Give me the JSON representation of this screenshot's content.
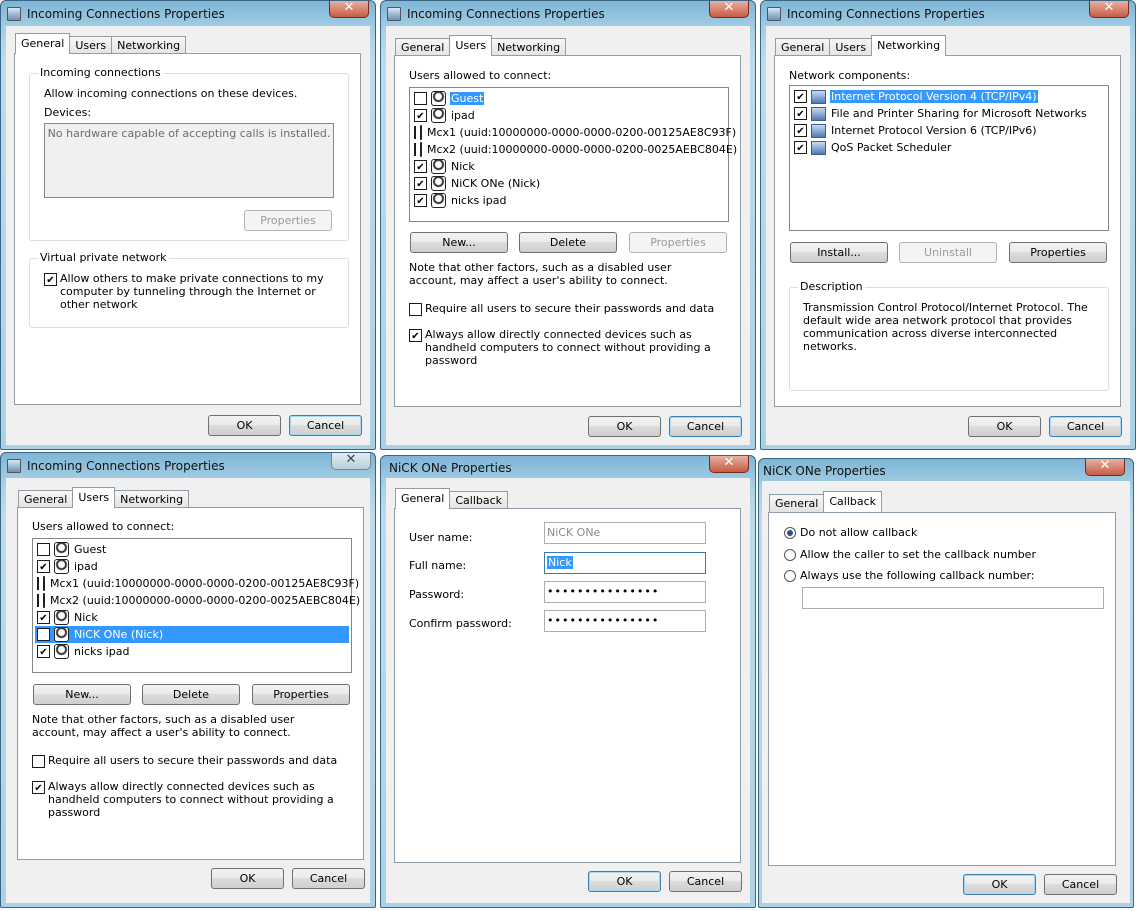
{
  "w1": {
    "title": "Incoming Connections Properties",
    "tabs": [
      "General",
      "Users",
      "Networking"
    ],
    "group_incoming": "Incoming connections",
    "allow_text": "Allow incoming connections on these devices.",
    "devices_label": "Devices:",
    "devices_empty": "No hardware capable of accepting calls is installed.",
    "properties_btn": "Properties",
    "group_vpn": "Virtual private network",
    "vpn_checkbox": "Allow others to make private connections to my computer by tunneling through the Internet or other network",
    "ok": "OK",
    "cancel": "Cancel"
  },
  "w2": {
    "title": "Incoming Connections Properties",
    "tabs": [
      "General",
      "Users",
      "Networking"
    ],
    "users_label": "Users allowed to connect:",
    "users": [
      {
        "name": "Guest",
        "checked": false
      },
      {
        "name": "ipad",
        "checked": true
      },
      {
        "name": "Mcx1 (uuid:10000000-0000-0000-0200-00125AE8C93F)",
        "checked": false
      },
      {
        "name": "Mcx2 (uuid:10000000-0000-0000-0200-0025AEBC804E)",
        "checked": false
      },
      {
        "name": "Nick",
        "checked": true
      },
      {
        "name": "NiCK ONe (Nick)",
        "checked": true
      },
      {
        "name": "nicks ipad",
        "checked": true
      }
    ],
    "new_btn": "New...",
    "delete_btn": "Delete",
    "properties_btn": "Properties",
    "note": "Note that other factors, such as a disabled user account, may affect a user's ability to connect.",
    "require_cb": "Require all users to secure their passwords and data",
    "always_cb": "Always allow directly connected devices such as handheld computers to connect without providing a password",
    "ok": "OK",
    "cancel": "Cancel"
  },
  "w3": {
    "title": "Incoming Connections Properties",
    "tabs": [
      "General",
      "Users",
      "Networking"
    ],
    "components_label": "Network components:",
    "components": [
      {
        "name": "Internet Protocol Version 4 (TCP/IPv4)",
        "checked": true
      },
      {
        "name": "File and Printer Sharing for Microsoft Networks",
        "checked": true
      },
      {
        "name": "Internet Protocol Version 6 (TCP/IPv6)",
        "checked": true
      },
      {
        "name": "QoS Packet Scheduler",
        "checked": true
      }
    ],
    "install_btn": "Install...",
    "uninstall_btn": "Uninstall",
    "properties_btn": "Properties",
    "desc_title": "Description",
    "desc_text": "Transmission Control Protocol/Internet Protocol. The default wide area network protocol that provides communication across diverse interconnected networks.",
    "ok": "OK",
    "cancel": "Cancel"
  },
  "w4": {
    "title": "Incoming Connections Properties",
    "tabs": [
      "General",
      "Users",
      "Networking"
    ],
    "users_label": "Users allowed to connect:",
    "new_btn": "New...",
    "delete_btn": "Delete",
    "properties_btn": "Properties",
    "note": "Note that other factors, such as a disabled user account, may affect a user's ability to connect.",
    "require_cb": "Require all users to secure their passwords and data",
    "always_cb": "Always allow directly connected devices such as handheld computers to connect without providing a password",
    "ok": "OK",
    "cancel": "Cancel"
  },
  "w5": {
    "title": "NiCK ONe Properties",
    "tabs": [
      "General",
      "Callback"
    ],
    "username_label": "User name:",
    "username_value": "NiCK ONe",
    "fullname_label": "Full name:",
    "fullname_value": "Nick",
    "password_label": "Password:",
    "password_value": "•••••••••••••••",
    "confirm_label": "Confirm password:",
    "confirm_value": "•••••••••••••••",
    "ok": "OK",
    "cancel": "Cancel"
  },
  "w6": {
    "title": "NiCK ONe Properties",
    "tabs": [
      "General",
      "Callback"
    ],
    "opt_no": "Do not allow callback",
    "opt_caller": "Allow the caller to set the callback number",
    "opt_always": "Always use the following callback number:",
    "callback_number": "",
    "ok": "OK",
    "cancel": "Cancel"
  },
  "colors": {
    "selection": "#3399ff",
    "title_bar": "#a7d0e6"
  }
}
